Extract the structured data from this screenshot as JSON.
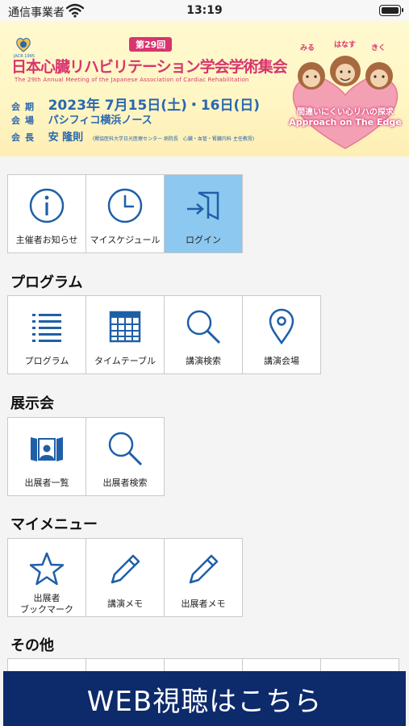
{
  "status_bar": {
    "carrier": "通信事業者",
    "time": "13:19"
  },
  "banner": {
    "logo_text": "JACR 1995",
    "edition": "第29回",
    "title": "日本心臓リハビリテーション学会学術集会",
    "subtitle": "The 29th Annual Meeting of the Japanese Association of Cardiac Rehabilitation",
    "period_label": "会期",
    "period_value": "2023年 7月15日(土)・16日(日)",
    "venue_label": "会場",
    "venue_value": "パシフィコ横浜ノース",
    "chair_label": "会長",
    "chair_name": "安 隆則",
    "chair_note": "(獨協医科大学日光医療センター 病院長　心臓・血管・腎臓内科 主任教授)",
    "mascot_words": [
      "みる",
      "はなす",
      "きく"
    ],
    "theme_jp": "間違いにくい心リハの探求",
    "theme_en": "Approach on The Edge"
  },
  "top_tiles": [
    {
      "label": "主催者お知らせ",
      "icon": "info-icon"
    },
    {
      "label": "マイスケジュール",
      "icon": "clock-icon"
    },
    {
      "label": "ログイン",
      "icon": "login-icon"
    }
  ],
  "sections": {
    "program": {
      "title": "プログラム",
      "tiles": [
        {
          "label": "プログラム",
          "icon": "list-icon"
        },
        {
          "label": "タイムテーブル",
          "icon": "calendar-icon"
        },
        {
          "label": "講演検索",
          "icon": "search-icon"
        },
        {
          "label": "講演会場",
          "icon": "map-pin-icon"
        }
      ]
    },
    "exhibition": {
      "title": "展示会",
      "tiles": [
        {
          "label": "出展者一覧",
          "icon": "exhibitor-booth-icon"
        },
        {
          "label": "出展者検索",
          "icon": "search-icon"
        }
      ]
    },
    "my_menu": {
      "title": "マイメニュー",
      "tiles": [
        {
          "label_line1": "出展者",
          "label_line2": "ブックマーク",
          "icon": "star-icon"
        },
        {
          "label": "講演メモ",
          "icon": "pencil-icon"
        },
        {
          "label": "出展者メモ",
          "icon": "pencil-icon"
        }
      ]
    },
    "other": {
      "title": "その他"
    }
  },
  "web_button": {
    "label": "WEB視聴はこちら"
  },
  "colors": {
    "accent_blue": "#1f5fa8",
    "highlight": "#8cc8ef",
    "banner_pink": "#d8356e",
    "web_button": "#0d2a6b"
  }
}
